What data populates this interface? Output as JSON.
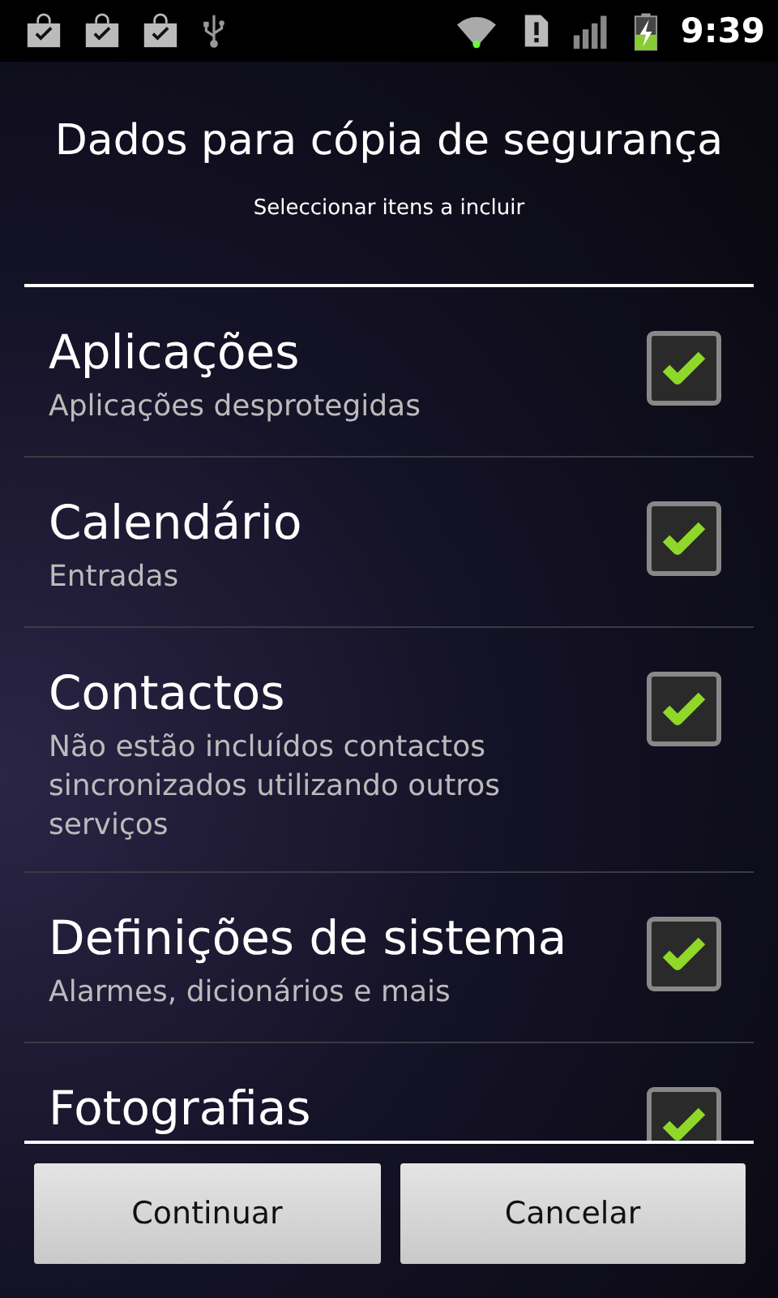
{
  "status_bar": {
    "time": "9:39"
  },
  "dialog": {
    "title": "Dados para cópia de segurança",
    "subtitle": "Seleccionar itens a incluir"
  },
  "items": [
    {
      "title": "Aplicações",
      "summary": "Aplicações desprotegidas",
      "checked": true
    },
    {
      "title": "Calendário",
      "summary": "Entradas",
      "checked": true
    },
    {
      "title": "Contactos",
      "summary": "Não estão incluídos contactos sincronizados utilizando outros serviços",
      "checked": true
    },
    {
      "title": "Definições de sistema",
      "summary": "Alarmes, dicionários e mais",
      "checked": true
    },
    {
      "title": "Fotografias",
      "checked": true
    }
  ],
  "buttons": [
    "Continuar",
    "Cancelar"
  ]
}
